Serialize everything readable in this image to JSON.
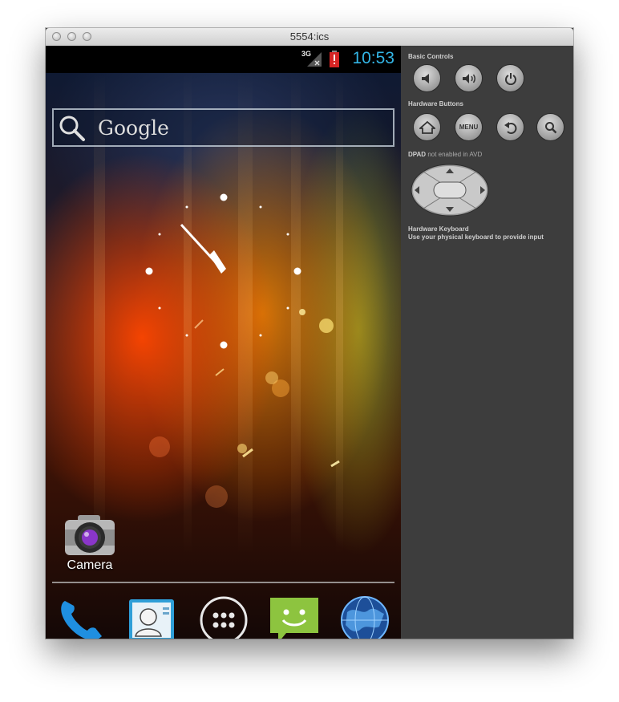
{
  "window": {
    "title": "5554:ics"
  },
  "status_bar": {
    "network": "3G",
    "time": "10:53"
  },
  "home": {
    "search_label": "Google",
    "shortcut_label": "Camera",
    "dock": [
      "phone",
      "contacts",
      "all-apps",
      "messaging",
      "browser"
    ]
  },
  "panel": {
    "basic_controls": "Basic Controls",
    "hardware_buttons": "Hardware Buttons",
    "menu_label": "MENU",
    "dpad_label": "DPAD",
    "dpad_hint": "not enabled in AVD",
    "keyboard_title": "Hardware Keyboard",
    "keyboard_hint": "Use your physical keyboard to provide input"
  },
  "colors": {
    "clock": "#33b5e5",
    "panel": "#3d3d3d",
    "battery": "#d62424",
    "message": "#8dc43f"
  }
}
